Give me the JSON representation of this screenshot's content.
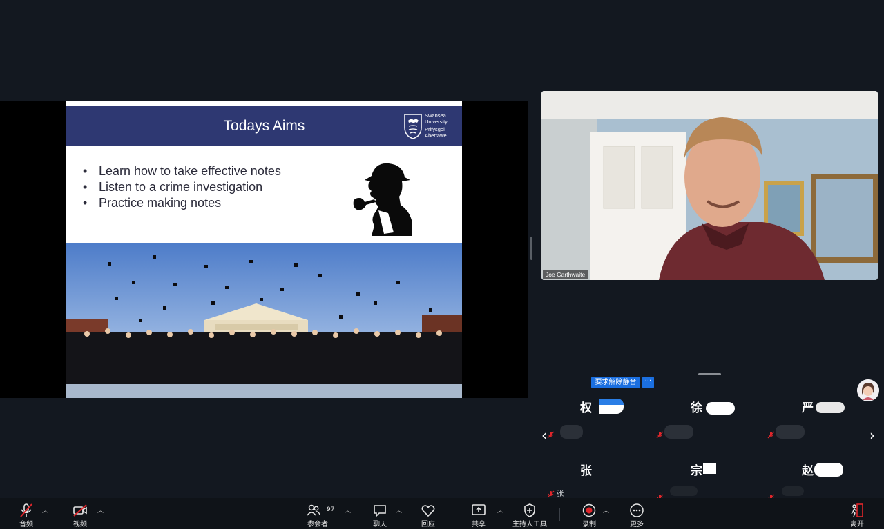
{
  "slide": {
    "title": "Todays Aims",
    "logo_lines": [
      "Swansea",
      "University",
      "Prifysgol",
      "Abertawe"
    ],
    "bullets": [
      "Learn how to take effective notes",
      "Listen to a crime investigation",
      "Practice making notes"
    ],
    "header_color": "#2e3872"
  },
  "video": {
    "speaker_name": "Joe Garthwaite"
  },
  "gallery": {
    "unmute_request_label": "要求解除静音",
    "more_label": "···",
    "participants": [
      {
        "name": "权",
        "sub": ""
      },
      {
        "name": "徐",
        "sub": ""
      },
      {
        "name": "严",
        "sub": ""
      },
      {
        "name": "张",
        "sub": "张"
      },
      {
        "name": "宗",
        "sub": ""
      },
      {
        "name": "赵",
        "sub": ""
      }
    ]
  },
  "toolbar": {
    "audio": "音频",
    "video": "视频",
    "participants": "参会者",
    "participants_count": "97",
    "chat": "聊天",
    "react": "回应",
    "share": "共享",
    "host_tools": "主持人工具",
    "record": "录制",
    "more": "更多",
    "leave": "离开"
  },
  "colors": {
    "accent": "#1b6fe0",
    "record": "#e0262b",
    "muted": "#e0262b"
  }
}
